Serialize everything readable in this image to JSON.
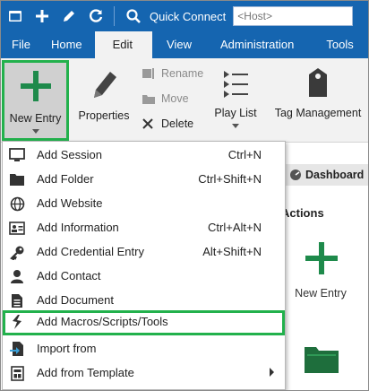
{
  "quick_access": {
    "quick_connect_label": "Quick Connect",
    "host_placeholder": "<Host>",
    "icons": [
      "window-icon",
      "add-icon",
      "edit-icon",
      "refresh-icon",
      "search-icon"
    ]
  },
  "tabs": [
    {
      "label": "File",
      "active": false
    },
    {
      "label": "Home",
      "active": false
    },
    {
      "label": "Edit",
      "active": true
    },
    {
      "label": "View",
      "active": false
    },
    {
      "label": "Administration",
      "active": false
    },
    {
      "label": "Tools",
      "active": false
    }
  ],
  "ribbon": {
    "new_entry": "New Entry",
    "properties": "Properties",
    "rename": "Rename",
    "move": "Move",
    "delete": "Delete",
    "play_list": "Play List",
    "tag_management": "Tag Management"
  },
  "background": {
    "dashboard": "Dashboard",
    "actions": "Actions",
    "new_entry": "New Entry"
  },
  "menu": {
    "items": [
      {
        "label": "Add Session",
        "shortcut": "Ctrl+N",
        "icon": "monitor-icon"
      },
      {
        "label": "Add Folder",
        "shortcut": "Ctrl+Shift+N",
        "icon": "folder-icon"
      },
      {
        "label": "Add Website",
        "shortcut": "",
        "icon": "globe-icon"
      },
      {
        "label": "Add Information",
        "shortcut": "Ctrl+Alt+N",
        "icon": "id-card-icon"
      },
      {
        "label": "Add Credential Entry",
        "shortcut": "Alt+Shift+N",
        "icon": "key-icon"
      },
      {
        "label": "Add Contact",
        "shortcut": "",
        "icon": "contact-icon"
      },
      {
        "label": "Add Document",
        "shortcut": "",
        "icon": "document-icon"
      },
      {
        "label": "Add Macros/Scripts/Tools",
        "shortcut": "",
        "icon": "macro-icon",
        "highlighted": true
      },
      {
        "label": "Import from",
        "shortcut": "",
        "icon": "import-icon"
      },
      {
        "label": "Add from Template",
        "shortcut": "",
        "icon": "template-icon",
        "submenu": true
      }
    ]
  },
  "colors": {
    "ribbon_blue": "#1565b0",
    "highlight_green": "#22b14c",
    "accent_green": "#1e8a4b"
  }
}
